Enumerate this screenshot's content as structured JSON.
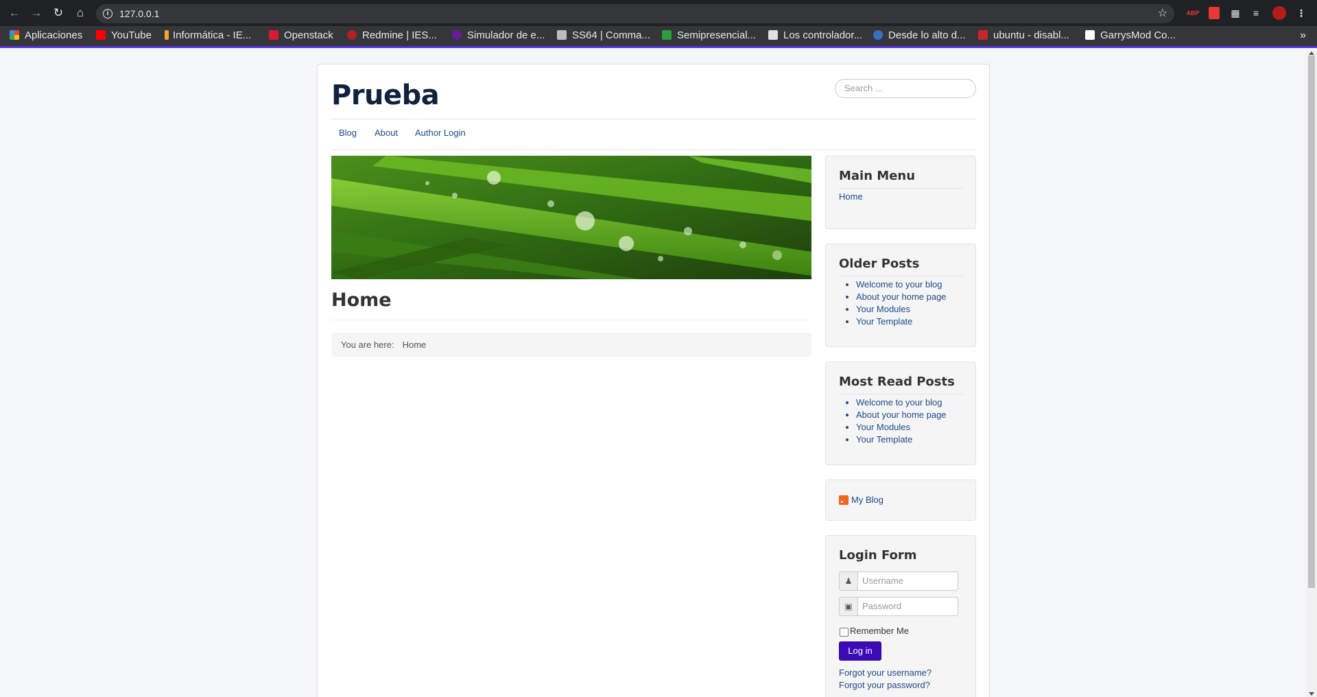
{
  "browser": {
    "url": "127.0.0.1",
    "bookmarks": [
      {
        "label": "Aplicaciones",
        "color": "#4285f4"
      },
      {
        "label": "YouTube",
        "color": "#ff0000"
      },
      {
        "label": "Informática - IE...",
        "color": "#f5a623"
      },
      {
        "label": "Openstack",
        "color": "#da1a32"
      },
      {
        "label": "Redmine | IES...",
        "color": "#b32024"
      },
      {
        "label": "Simulador de e...",
        "color": "#6a1b9a"
      },
      {
        "label": "SS64 | Comma...",
        "color": "#bdbdbd"
      },
      {
        "label": "Semipresencial...",
        "color": "#2e9d3a"
      },
      {
        "label": "Los controlador...",
        "color": "#e0e0e0"
      },
      {
        "label": "Desde lo alto d...",
        "color": "#3b6fc4"
      },
      {
        "label": "ubuntu - disabl...",
        "color": "#c62828"
      },
      {
        "label": "GarrysMod Co...",
        "color": "#ffffff"
      }
    ],
    "more_bookmarks": "»",
    "extensions": [
      {
        "label": "ABP",
        "color": "#c70d2c"
      },
      {
        "label": "",
        "color": "#e53935"
      }
    ]
  },
  "site": {
    "brand": "Prueba",
    "search_placeholder": "Search ...",
    "nav": [
      "Blog",
      "About",
      "Author Login"
    ],
    "page_title": "Home",
    "breadcrumb": {
      "prefix": "You are here:",
      "current": "Home"
    }
  },
  "sidebar": {
    "main_menu": {
      "title": "Main Menu",
      "items": [
        "Home"
      ]
    },
    "older_posts": {
      "title": "Older Posts",
      "items": [
        "Welcome to your blog",
        "About your home page",
        "Your Modules",
        "Your Template"
      ]
    },
    "most_read": {
      "title": "Most Read Posts",
      "items": [
        "Welcome to your blog",
        "About your home page",
        "Your Modules",
        "Your Template"
      ]
    },
    "feed": {
      "label": "My Blog"
    },
    "login": {
      "title": "Login Form",
      "username_placeholder": "Username",
      "password_placeholder": "Password",
      "remember_label": "Remember Me",
      "submit_label": "Log in",
      "forgot_username": "Forgot your username?",
      "forgot_password": "Forgot your password?"
    }
  },
  "colors": {
    "accent": "#3d0ab8",
    "link": "#1d4a8a",
    "brand": "#10223e"
  }
}
